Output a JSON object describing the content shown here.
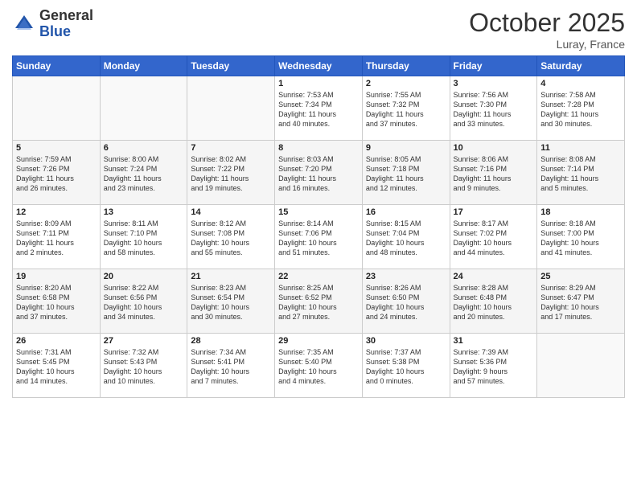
{
  "logo": {
    "general": "General",
    "blue": "Blue"
  },
  "header": {
    "month": "October 2025",
    "location": "Luray, France"
  },
  "days": [
    "Sunday",
    "Monday",
    "Tuesday",
    "Wednesday",
    "Thursday",
    "Friday",
    "Saturday"
  ],
  "weeks": [
    [
      {
        "day": "",
        "content": ""
      },
      {
        "day": "",
        "content": ""
      },
      {
        "day": "",
        "content": ""
      },
      {
        "day": "1",
        "content": "Sunrise: 7:53 AM\nSunset: 7:34 PM\nDaylight: 11 hours\nand 40 minutes."
      },
      {
        "day": "2",
        "content": "Sunrise: 7:55 AM\nSunset: 7:32 PM\nDaylight: 11 hours\nand 37 minutes."
      },
      {
        "day": "3",
        "content": "Sunrise: 7:56 AM\nSunset: 7:30 PM\nDaylight: 11 hours\nand 33 minutes."
      },
      {
        "day": "4",
        "content": "Sunrise: 7:58 AM\nSunset: 7:28 PM\nDaylight: 11 hours\nand 30 minutes."
      }
    ],
    [
      {
        "day": "5",
        "content": "Sunrise: 7:59 AM\nSunset: 7:26 PM\nDaylight: 11 hours\nand 26 minutes."
      },
      {
        "day": "6",
        "content": "Sunrise: 8:00 AM\nSunset: 7:24 PM\nDaylight: 11 hours\nand 23 minutes."
      },
      {
        "day": "7",
        "content": "Sunrise: 8:02 AM\nSunset: 7:22 PM\nDaylight: 11 hours\nand 19 minutes."
      },
      {
        "day": "8",
        "content": "Sunrise: 8:03 AM\nSunset: 7:20 PM\nDaylight: 11 hours\nand 16 minutes."
      },
      {
        "day": "9",
        "content": "Sunrise: 8:05 AM\nSunset: 7:18 PM\nDaylight: 11 hours\nand 12 minutes."
      },
      {
        "day": "10",
        "content": "Sunrise: 8:06 AM\nSunset: 7:16 PM\nDaylight: 11 hours\nand 9 minutes."
      },
      {
        "day": "11",
        "content": "Sunrise: 8:08 AM\nSunset: 7:14 PM\nDaylight: 11 hours\nand 5 minutes."
      }
    ],
    [
      {
        "day": "12",
        "content": "Sunrise: 8:09 AM\nSunset: 7:11 PM\nDaylight: 11 hours\nand 2 minutes."
      },
      {
        "day": "13",
        "content": "Sunrise: 8:11 AM\nSunset: 7:10 PM\nDaylight: 10 hours\nand 58 minutes."
      },
      {
        "day": "14",
        "content": "Sunrise: 8:12 AM\nSunset: 7:08 PM\nDaylight: 10 hours\nand 55 minutes."
      },
      {
        "day": "15",
        "content": "Sunrise: 8:14 AM\nSunset: 7:06 PM\nDaylight: 10 hours\nand 51 minutes."
      },
      {
        "day": "16",
        "content": "Sunrise: 8:15 AM\nSunset: 7:04 PM\nDaylight: 10 hours\nand 48 minutes."
      },
      {
        "day": "17",
        "content": "Sunrise: 8:17 AM\nSunset: 7:02 PM\nDaylight: 10 hours\nand 44 minutes."
      },
      {
        "day": "18",
        "content": "Sunrise: 8:18 AM\nSunset: 7:00 PM\nDaylight: 10 hours\nand 41 minutes."
      }
    ],
    [
      {
        "day": "19",
        "content": "Sunrise: 8:20 AM\nSunset: 6:58 PM\nDaylight: 10 hours\nand 37 minutes."
      },
      {
        "day": "20",
        "content": "Sunrise: 8:22 AM\nSunset: 6:56 PM\nDaylight: 10 hours\nand 34 minutes."
      },
      {
        "day": "21",
        "content": "Sunrise: 8:23 AM\nSunset: 6:54 PM\nDaylight: 10 hours\nand 30 minutes."
      },
      {
        "day": "22",
        "content": "Sunrise: 8:25 AM\nSunset: 6:52 PM\nDaylight: 10 hours\nand 27 minutes."
      },
      {
        "day": "23",
        "content": "Sunrise: 8:26 AM\nSunset: 6:50 PM\nDaylight: 10 hours\nand 24 minutes."
      },
      {
        "day": "24",
        "content": "Sunrise: 8:28 AM\nSunset: 6:48 PM\nDaylight: 10 hours\nand 20 minutes."
      },
      {
        "day": "25",
        "content": "Sunrise: 8:29 AM\nSunset: 6:47 PM\nDaylight: 10 hours\nand 17 minutes."
      }
    ],
    [
      {
        "day": "26",
        "content": "Sunrise: 7:31 AM\nSunset: 5:45 PM\nDaylight: 10 hours\nand 14 minutes."
      },
      {
        "day": "27",
        "content": "Sunrise: 7:32 AM\nSunset: 5:43 PM\nDaylight: 10 hours\nand 10 minutes."
      },
      {
        "day": "28",
        "content": "Sunrise: 7:34 AM\nSunset: 5:41 PM\nDaylight: 10 hours\nand 7 minutes."
      },
      {
        "day": "29",
        "content": "Sunrise: 7:35 AM\nSunset: 5:40 PM\nDaylight: 10 hours\nand 4 minutes."
      },
      {
        "day": "30",
        "content": "Sunrise: 7:37 AM\nSunset: 5:38 PM\nDaylight: 10 hours\nand 0 minutes."
      },
      {
        "day": "31",
        "content": "Sunrise: 7:39 AM\nSunset: 5:36 PM\nDaylight: 9 hours\nand 57 minutes."
      },
      {
        "day": "",
        "content": ""
      }
    ]
  ]
}
